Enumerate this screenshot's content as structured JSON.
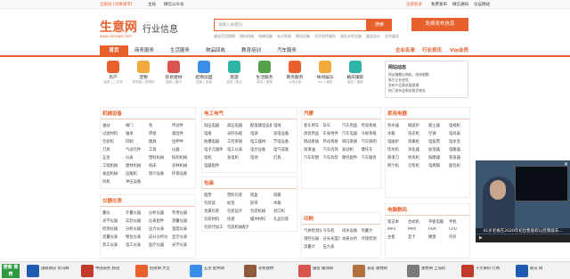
{
  "topbar": {
    "left": [
      "全部站 [切换城市]",
      "主站",
      "微信公众号"
    ],
    "right": [
      "注册登录",
      "免费发布",
      "微信通知",
      "论坛网站"
    ]
  },
  "logo": {
    "name": "生意网",
    "url": "www.sxmaps.com",
    "slogan": "行业信息"
  },
  "search": {
    "placeholder": "请输入关键词",
    "button": "搜索"
  },
  "hotwords": [
    "通化百货购物",
    "塑料机械",
    "电梯设备",
    "长沙家具",
    "建设设备",
    "北京宣传服务",
    "湖北水利设施",
    "展会设计",
    "北京展览"
  ],
  "publish_button": "免费发布信息",
  "nav": {
    "items": [
      "首页",
      "商务服务",
      "生活服务",
      "物品回收",
      "教育培训",
      "汽车服务"
    ],
    "right": [
      "企业名录",
      "行业资讯",
      "Vip会员"
    ]
  },
  "categories": [
    {
      "label": "房产",
      "sub": "租房 | 二手房",
      "icon": "house-icon",
      "color": "#e8612c"
    },
    {
      "label": "宠物",
      "sub": "宠物猫 | 宠物狗",
      "icon": "paw-icon",
      "color": "#f2a93b"
    },
    {
      "label": "装修建材",
      "sub": "装修 | 建材",
      "icon": "paint-icon",
      "color": "#d9534f"
    },
    {
      "label": "招商加盟",
      "sub": "招商 | 加盟",
      "icon": "handshake-icon",
      "color": "#3a8ee6"
    },
    {
      "label": "旅游",
      "sub": "旅游 | 景点",
      "icon": "bus-icon",
      "color": "#2fb5a8"
    },
    {
      "label": "生活服务",
      "sub": "保洁 | 搬家",
      "icon": "service-icon",
      "color": "#56a04a"
    },
    {
      "label": "商务服务",
      "sub": "公司注册",
      "icon": "briefcase-icon",
      "color": "#e8612c"
    },
    {
      "label": "休闲娱乐",
      "sub": "ktv | 酒吧",
      "icon": "cup-icon",
      "color": "#f2a93b"
    },
    {
      "label": "婚庆摄影",
      "sub": "婚庆 | 摄影",
      "icon": "camera-icon",
      "color": "#2fb5a8"
    }
  ],
  "news": {
    "title": "网站动态",
    "lines": [
      "热议佛教出海化，成体细胞",
      "吸引企业进驻",
      "发布产品需求量稳增",
      "热门发布会需求稳步增长"
    ]
  },
  "side_tabs": [
    "企业名录",
    "行业资讯",
    "Vip会员"
  ],
  "sections": [
    {
      "title": "机械设备",
      "items": [
        "油站",
        "阀门",
        "泵",
        "传动件",
        "过滤材料",
        "轴承",
        "焊接",
        "紧固件",
        "包装机",
        "印刷",
        "模具",
        "拉伸件",
        "刀具",
        "气动元件",
        "工具",
        "仪器",
        "五金",
        "仪表",
        "塑料机械",
        "纺织机械",
        "工程机械",
        "建材机械",
        "机床",
        "农林机械",
        "食品机械",
        "压缩机",
        "制冷设备",
        "环保设备",
        "风机",
        "冲压设备"
      ]
    },
    {
      "title": "电工电气",
      "items": [
        "低压电器",
        "高压电器",
        "配电输电设备",
        "电线",
        "电缆",
        "光纤光缆",
        "电源",
        "充电设备",
        "防爆电器",
        "工控系统",
        "电工器材",
        "节电设备",
        "电子元器件",
        "电工仪表",
        "电力设备",
        "电气成套",
        "电机",
        "发电机",
        "电池",
        "灯具",
        "电器配件"
      ]
    },
    {
      "title": "包装",
      "items": [
        "瓶塑",
        "塑料包装",
        "纸盒",
        "纸箱",
        "包装袋",
        "标签",
        "胶带",
        "木箱",
        "金属包装",
        "包装设计",
        "包装机械",
        "封口机",
        "包装材料",
        "托盘",
        "缓冲材料",
        "礼品包装",
        "包装代加工",
        "包装机械配件"
      ]
    },
    {
      "title": "汽摩",
      "items": [
        "客车用车",
        "货车",
        "汽车用品",
        "传动系统",
        "改装用品",
        "车身附件",
        "汽车电器",
        "冷却系统",
        "制动系统",
        "传动系统",
        "转向系统",
        "汽车照明",
        "润滑油",
        "汽车内饰",
        "发动机",
        "摩托车",
        "汽车轮胎",
        "汽车改装",
        "摩托配件",
        "汽车服务"
      ]
    },
    {
      "title": "家用电器",
      "items": [
        "热水器",
        "微波炉",
        "吸尘器",
        "电视机",
        "冰箱",
        "洗衣机",
        "空调",
        "电风扇",
        "电磁炉",
        "消毒柜",
        "电饭煲",
        "电水壶",
        "饮水机",
        "净化器",
        "加湿器",
        "电暖器",
        "剃须刀",
        "吹风机",
        "按摩器",
        "卷发器",
        "榨汁机",
        "豆浆机",
        "电烤箱",
        "面包机"
      ]
    },
    {
      "title": "仪器仪表",
      "items": [
        "量仪",
        "计量仪器",
        "分析仪器",
        "专用仪器",
        "光学仪器",
        "实验仪器",
        "仪表配件",
        "测量仪器",
        "检测仪器",
        "分析仪器",
        "压力仪表",
        "温度仪表",
        "流量仪表",
        "物位仪表",
        "成分分析仪",
        "显示仪表",
        "热工仪表",
        "电工仪表",
        "医疗仪器",
        "光学仪表"
      ]
    },
    {
      "title": "印刷",
      "items": [
        "气体检测仪",
        "冷冻机",
        "排水设备",
        "热量计",
        "测控仪器",
        "分光光度计",
        "水质分析",
        "环境检测",
        "流量计",
        "压力表"
      ]
    },
    {
      "title": "电脑数码",
      "items": [
        "笔记本",
        "台式机",
        "平板电脑",
        "手机",
        "MP3",
        "MP4",
        "PDA",
        "CPU",
        "主板",
        "显卡",
        "硬盘",
        "内存"
      ]
    }
  ],
  "side_ad": {
    "caption": "41岁老板在2020年初出售股权以后我就去...",
    "close": "✕",
    "controls": "▶"
  },
  "bottom": {
    "brand": "搜索 推荐",
    "ads": [
      {
        "text": "国联期货 资讯网",
        "color": "#1f5bb5"
      },
      {
        "text": "中国商务 频道",
        "color": "#c0392b"
      },
      {
        "text": "招商网 大全",
        "color": "#e8612c"
      },
      {
        "text": "五金 配件网",
        "color": "#3a8ee6"
      },
      {
        "text": "装修建材",
        "color": "#8e5a3b"
      },
      {
        "text": "服装 服饰网",
        "color": "#d9534f"
      },
      {
        "text": "家居 建材网",
        "color": "#b07040"
      },
      {
        "text": "建材网 上海机",
        "color": "#7a7a7a"
      },
      {
        "text": "十大黄料 行情",
        "color": "#c0392b"
      },
      {
        "text": "期货 网",
        "color": "#1f5bb5"
      }
    ]
  }
}
